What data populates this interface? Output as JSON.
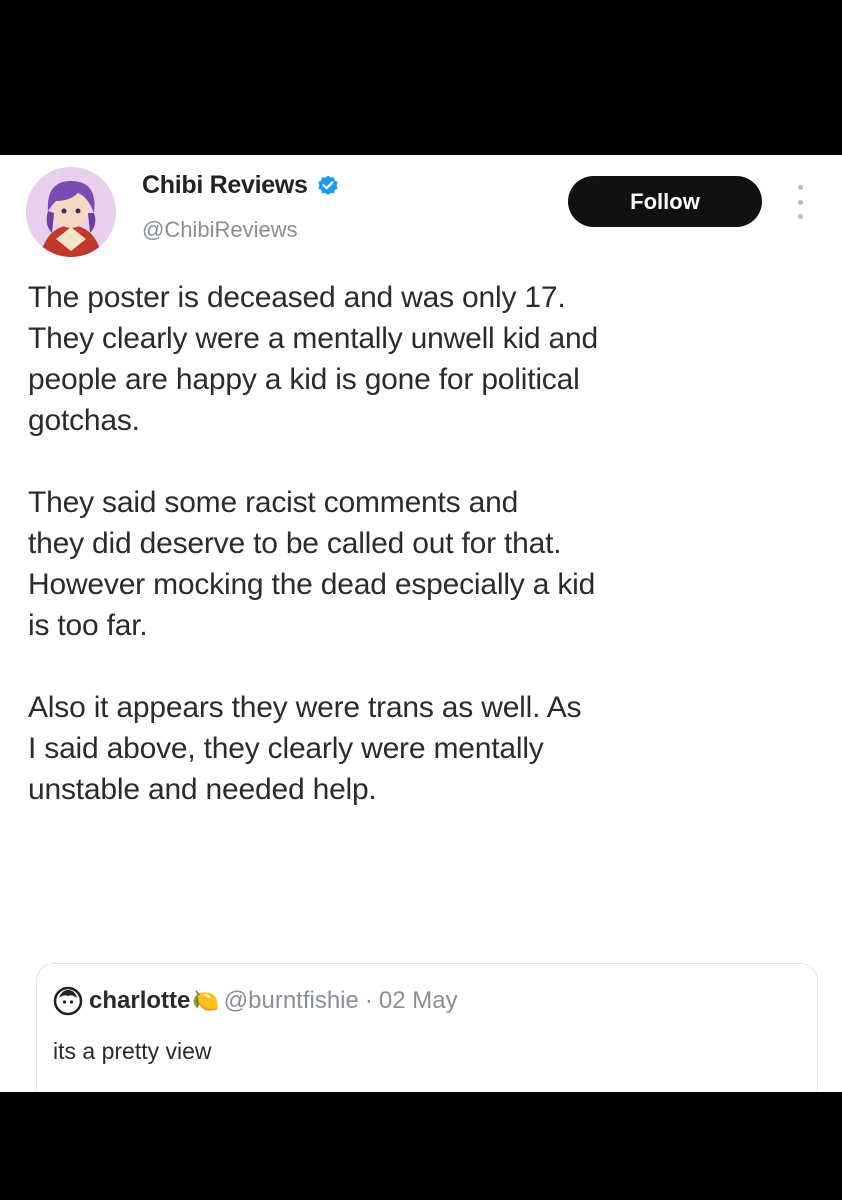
{
  "author": {
    "name": "Chibi Reviews",
    "handle": "@ChibiReviews",
    "verified": true,
    "avatar_icon": "anime-character-avatar"
  },
  "follow_label": "Follow",
  "menu_icon": "more-options-icon",
  "post": {
    "paragraphs": [
      "The poster is deceased and was only 17.\nThey clearly were a mentally unwell kid and\npeople are happy a kid is gone for political\ngotchas.",
      "They said some racist comments and\nthey did deserve to be called out for that.\nHowever mocking the dead especially a kid\nis too far.",
      "Also it appears they were trans as well. As\nI said above, they clearly were mentally\nunstable and needed help."
    ]
  },
  "quoted_post": {
    "name": "charlotte",
    "emoji": "🍋",
    "handle": "@burntfishie",
    "separator": "·",
    "date": "02 May",
    "text": "its a pretty view"
  },
  "colors": {
    "verified_badge": "#1d9bf0",
    "follow_bg": "#111111",
    "background_frame": "#000000"
  }
}
